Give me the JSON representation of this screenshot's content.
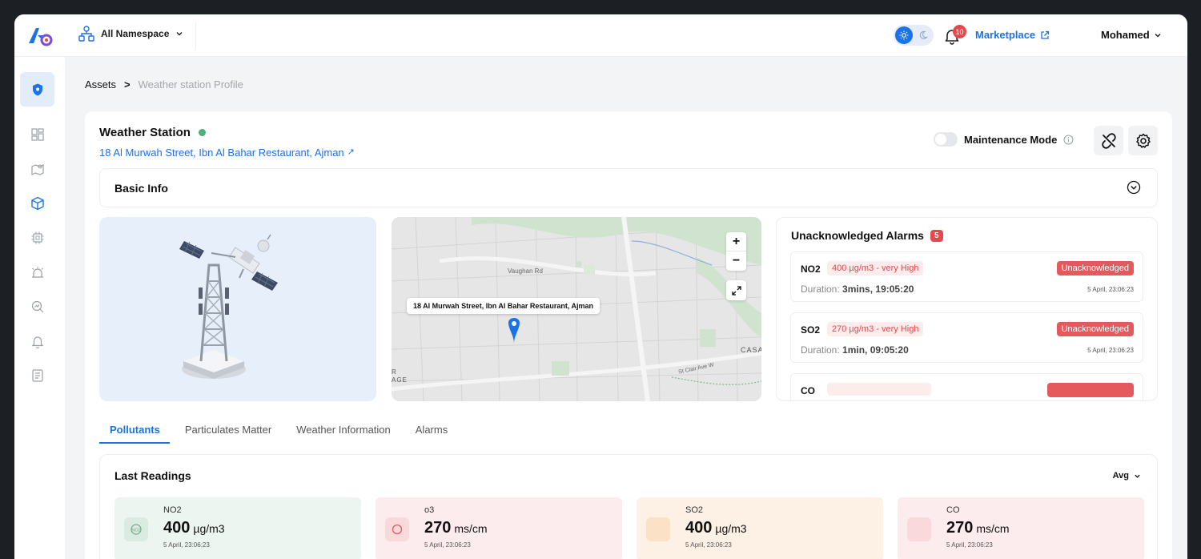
{
  "header": {
    "namespace": "All Namespace",
    "notifications": "10",
    "marketplace": "Marketplace",
    "user": "Mohamed"
  },
  "breadcrumb": {
    "root": "Assets",
    "separator": ">",
    "current": "Weather station Profile"
  },
  "station": {
    "title": "Weather Station",
    "address": "18 Al Murwah Street, Ibn Al Bahar Restaurant, Ajman",
    "address_arrow": "↗",
    "maintenance_label": "Maintenance Mode",
    "maintenance_on": false
  },
  "basic_info": {
    "label": "Basic Info"
  },
  "map": {
    "tooltip": "18 Al Murwah Street, Ibn Al Bahar Restaurant, Ajman",
    "zoom_in": "+",
    "zoom_out": "−",
    "labels": [
      "Vaughan Rd",
      "St Clair Ave W",
      "CASA",
      "R",
      "AGE"
    ]
  },
  "alarms": {
    "title": "Unacknowledged Alarms",
    "count": "5",
    "items": [
      {
        "name": "NO2",
        "level": "400 µg/m3 - very High",
        "status": "Unacknowledged",
        "duration_label": "Duration:",
        "duration": "3mins, 19:05:20",
        "timestamp": "5 April, 23:06:23"
      },
      {
        "name": "SO2",
        "level": "270 µg/m3 - very High",
        "status": "Unacknowledged",
        "duration_label": "Duration:",
        "duration": "1min, 09:05:20",
        "timestamp": "5 April, 23:06:23"
      },
      {
        "name": "CO",
        "level": "",
        "status": "",
        "duration_label": "",
        "duration": "",
        "timestamp": ""
      }
    ]
  },
  "tabs": [
    "Pollutants",
    "Particulates Matter",
    "Weather Information",
    "Alarms"
  ],
  "readings": {
    "title": "Last Readings",
    "aggregate": "Avg",
    "cards": [
      {
        "label": "NO2",
        "value": "400",
        "unit": "µg/m3",
        "timestamp": "5 April, 23:06:23",
        "bg": "#edf5f0",
        "icon_bg": "#dcebe1",
        "icon_color": "#6cae89",
        "icon": "no2-icon"
      },
      {
        "label": "o3",
        "value": "270",
        "unit": "ms/cm",
        "timestamp": "5 April, 23:06:23",
        "bg": "#fdeced",
        "icon_bg": "#f9d9db",
        "icon_color": "#e5585c",
        "icon": "ozone-icon"
      },
      {
        "label": "SO2",
        "value": "400",
        "unit": "µg/m3",
        "timestamp": "5 April, 23:06:23",
        "bg": "#fdf1e5",
        "icon_bg": "#fbe2c6",
        "icon_color": "#f0a042",
        "icon": "so2-icon"
      },
      {
        "label": "CO",
        "value": "270",
        "unit": "ms/cm",
        "timestamp": "5 April, 23:06:23",
        "bg": "#fdeced",
        "icon_bg": "#f9d9db",
        "icon_color": "#e5585c",
        "icon": "fire-icon"
      }
    ]
  },
  "colors": {
    "accent": "#1a73e8",
    "danger": "#e5484d",
    "online": "#4caf7d"
  }
}
